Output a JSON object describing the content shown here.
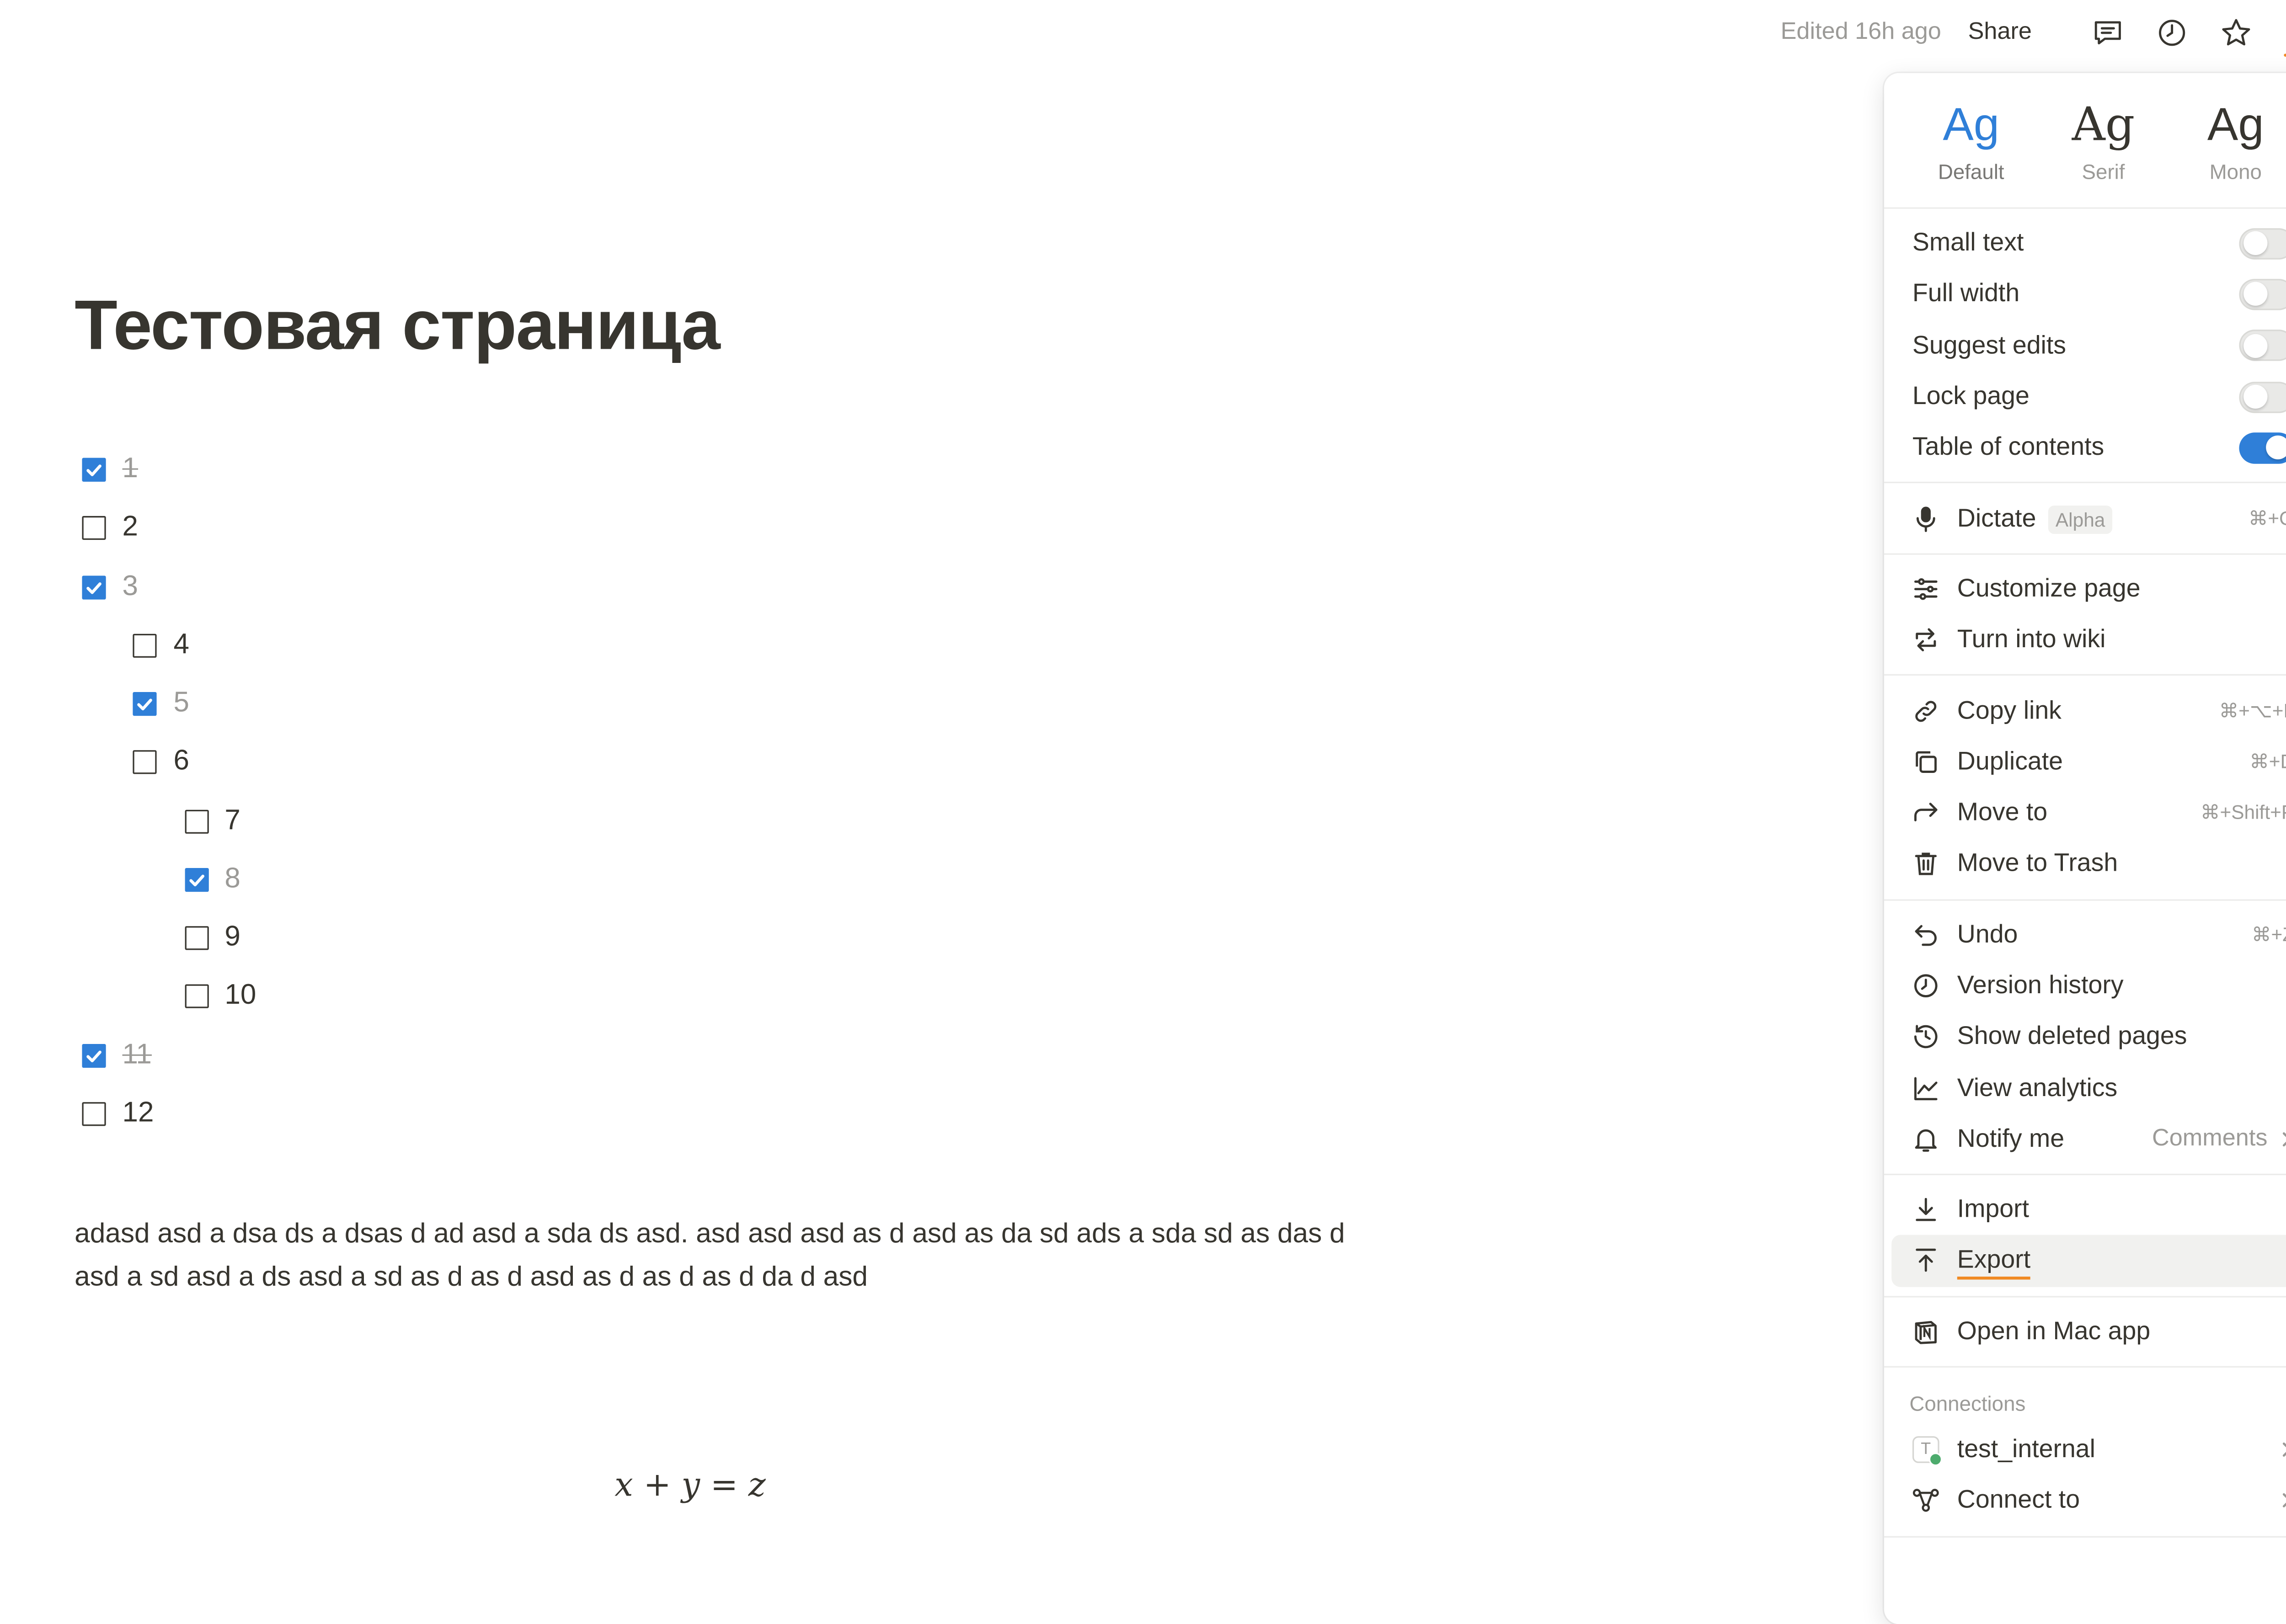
{
  "topbar": {
    "edited": "Edited 16h ago",
    "share": "Share",
    "icons": [
      "comment-icon",
      "clock-icon",
      "star-icon",
      "more-icon"
    ]
  },
  "page": {
    "title": "Тестовая страница",
    "todos": [
      {
        "text": "1",
        "checked": true,
        "strike": true,
        "level": 0
      },
      {
        "text": "2",
        "checked": false,
        "strike": false,
        "level": 0
      },
      {
        "text": "3",
        "checked": true,
        "strike": false,
        "level": 0
      },
      {
        "text": "4",
        "checked": false,
        "strike": false,
        "level": 1
      },
      {
        "text": "5",
        "checked": true,
        "strike": false,
        "level": 1
      },
      {
        "text": "6",
        "checked": false,
        "strike": false,
        "level": 1
      },
      {
        "text": "7",
        "checked": false,
        "strike": false,
        "level": 2
      },
      {
        "text": "8",
        "checked": true,
        "strike": false,
        "level": 2
      },
      {
        "text": "9",
        "checked": false,
        "strike": false,
        "level": 2
      },
      {
        "text": "10",
        "checked": false,
        "strike": false,
        "level": 2
      },
      {
        "text": "11",
        "checked": true,
        "strike": true,
        "level": 0
      },
      {
        "text": "12",
        "checked": false,
        "strike": false,
        "level": 0
      }
    ],
    "paragraph": "adasd asd a dsa ds a dsas d ad asd a sda ds asd. asd asd asd as d asd as da sd ads a sda sd as das d asd a sd asd a ds asd a sd as d as d asd as d as d as d da d asd",
    "math": "x + y = z"
  },
  "menu": {
    "fonts": [
      {
        "glyph": "Ag",
        "label": "Default",
        "active": true
      },
      {
        "glyph": "Ag",
        "label": "Serif",
        "active": false
      },
      {
        "glyph": "Ag",
        "label": "Mono",
        "active": false
      }
    ],
    "toggles": [
      {
        "label": "Small text",
        "on": false
      },
      {
        "label": "Full width",
        "on": false
      },
      {
        "label": "Suggest edits",
        "on": false
      },
      {
        "label": "Lock page",
        "on": false
      },
      {
        "label": "Table of contents",
        "on": true
      }
    ],
    "dictate": {
      "label": "Dictate",
      "badge": "Alpha",
      "shortcut": "⌘+O"
    },
    "customize": "Customize page",
    "wiki": "Turn into wiki",
    "copy_link": {
      "label": "Copy link",
      "shortcut": "⌘+⌥+L"
    },
    "duplicate": {
      "label": "Duplicate",
      "shortcut": "⌘+D"
    },
    "move_to": {
      "label": "Move to",
      "shortcut": "⌘+Shift+P"
    },
    "trash": "Move to Trash",
    "undo": {
      "label": "Undo",
      "shortcut": "⌘+Z"
    },
    "version_history": "Version history",
    "show_deleted": "Show deleted pages",
    "analytics": "View analytics",
    "notify": {
      "label": "Notify me",
      "value": "Comments"
    },
    "import": "Import",
    "export": "Export",
    "open_mac": "Open in Mac app",
    "connections_header": "Connections",
    "connection": {
      "label": "test_internal",
      "avatar": "T"
    },
    "connect_to": "Connect to"
  },
  "colors": {
    "accent": "#2f7fd8",
    "highlight_underline": "#f08a24",
    "text": "#37352f",
    "muted": "#9b9a97"
  }
}
